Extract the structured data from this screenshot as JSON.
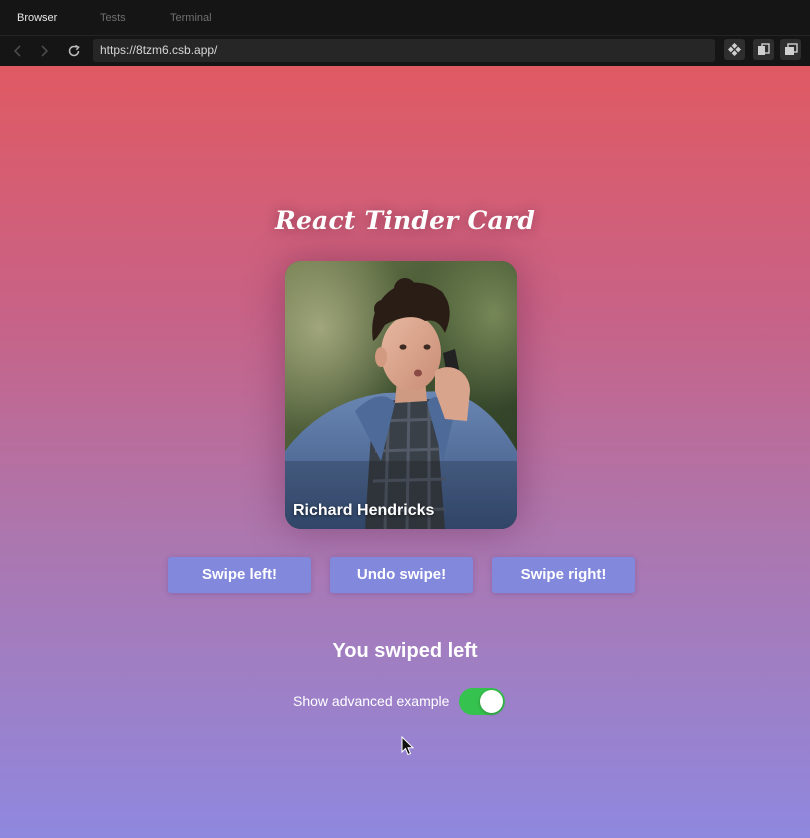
{
  "browser": {
    "tabs": [
      {
        "label": "Browser",
        "active": true
      },
      {
        "label": "Tests",
        "active": false
      },
      {
        "label": "Terminal",
        "active": false
      }
    ],
    "url": "https://8tzm6.csb.app/",
    "icons": {
      "back": "chevron-left-icon",
      "forward": "chevron-right-icon",
      "reload": "reload-icon",
      "tools": [
        "codesandbox-icon",
        "copy-icon",
        "windows-icon"
      ]
    }
  },
  "app": {
    "title": "React Tinder Card",
    "card": {
      "name": "Richard Hendricks"
    },
    "buttons": {
      "swipe_left": "Swipe left!",
      "undo": "Undo swipe!",
      "swipe_right": "Swipe right!"
    },
    "result": "You swiped left",
    "advanced": {
      "label": "Show advanced example",
      "enabled": true
    }
  },
  "colors": {
    "gradient_top": "#e05a63",
    "gradient_bottom": "#8f88df",
    "button": "#8288dc",
    "toggle_on": "#35c24e"
  }
}
